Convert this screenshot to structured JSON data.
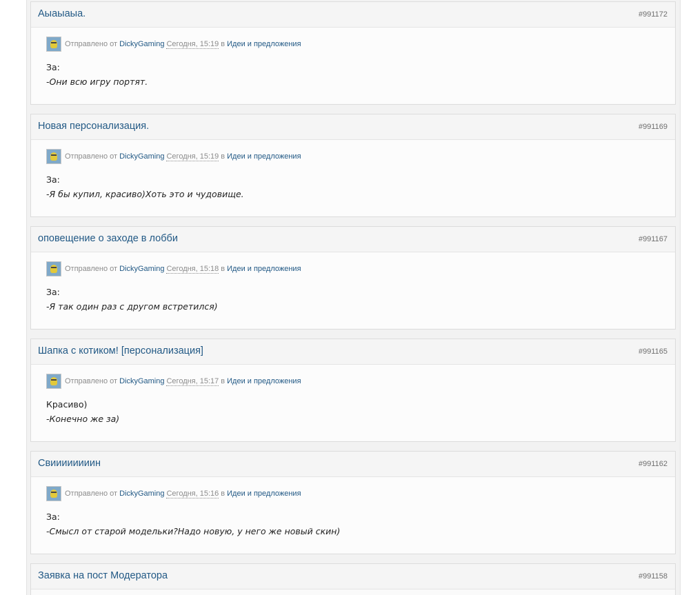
{
  "meta": {
    "sent_label": "Отправлено от",
    "in_label": "в"
  },
  "posts": [
    {
      "title": "Аыаыаыа.",
      "id": "#991172",
      "author": "DickyGaming",
      "time": "Сегодня, 15:19",
      "forum": "Идеи и предложения",
      "line1": "За:",
      "line2": "-Они всю игру портят."
    },
    {
      "title": "Новая персонализация.",
      "id": "#991169",
      "author": "DickyGaming",
      "time": "Сегодня, 15:19",
      "forum": "Идеи и предложения",
      "line1": "За:",
      "line2": "-Я бы купил, красиво)Хоть это и чудовище."
    },
    {
      "title": "оповещение о заходе в лобби",
      "id": "#991167",
      "author": "DickyGaming",
      "time": "Сегодня, 15:18",
      "forum": "Идеи и предложения",
      "line1": "За:",
      "line2": "-Я так один раз с другом встретился)"
    },
    {
      "title": "Шапка с котиком! [персонализация]",
      "id": "#991165",
      "author": "DickyGaming",
      "time": "Сегодня, 15:17",
      "forum": "Идеи и предложения",
      "line1": "Красиво)",
      "line2": "-Конечно же за)"
    },
    {
      "title": "Свиииииииин",
      "id": "#991162",
      "author": "DickyGaming",
      "time": "Сегодня, 15:16",
      "forum": "Идеи и предложения",
      "line1": "За:",
      "line2": "-Смысл от старой модельки?Надо новую, у него же новый скин)"
    },
    {
      "title": "Заявка на пост Модератора",
      "id": "#991158"
    }
  ]
}
